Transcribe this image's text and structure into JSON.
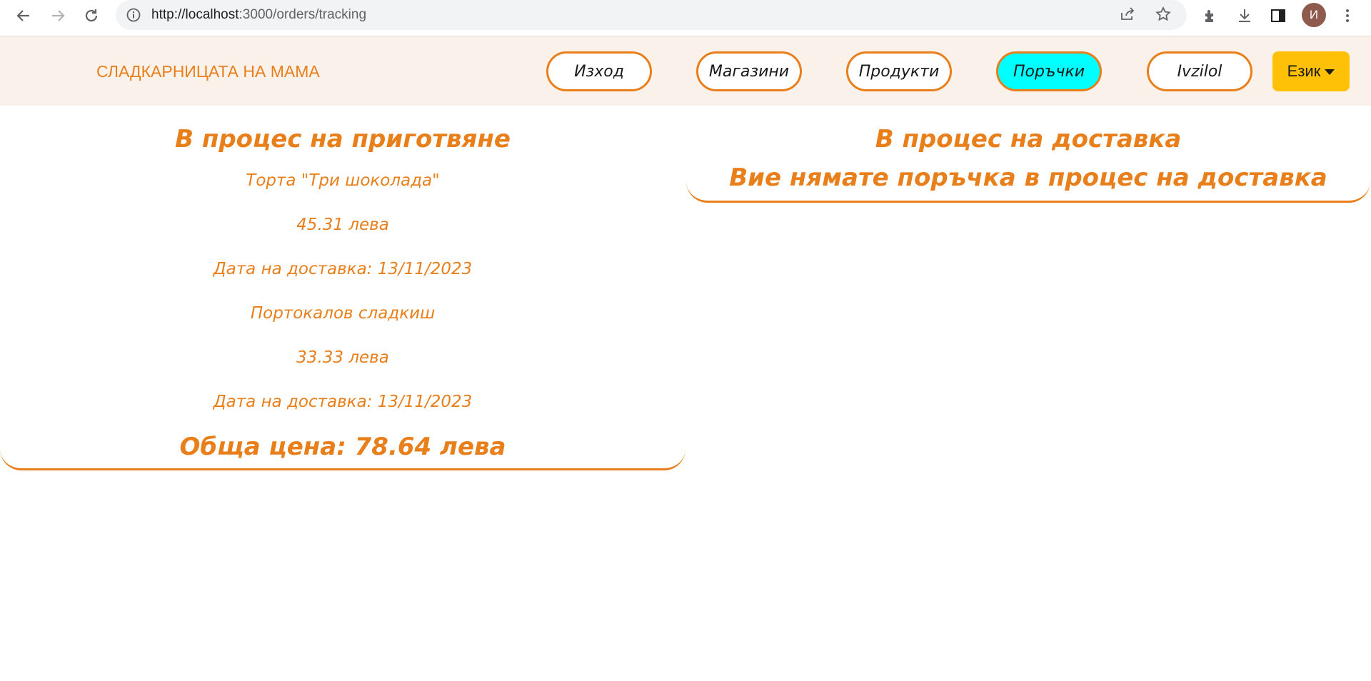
{
  "browser": {
    "url_host": "http://localhost",
    "url_path": ":3000/orders/tracking",
    "avatar_letter": "И"
  },
  "header": {
    "brand": "СЛАДКАРНИЦАТА НА МАМА",
    "nav": {
      "logout": "Изход",
      "stores": "Магазини",
      "products": "Продукти",
      "orders": "Поръчки",
      "user": "Ivzilol"
    },
    "language_label": "Език"
  },
  "in_preparation": {
    "title": "В процес на приготвяне",
    "orders": [
      {
        "name": "Торта \"Три шоколада\"",
        "price": "45.31 лева",
        "delivery": "Дата на доставка: 13/11/2023"
      },
      {
        "name": "Портокалов сладкиш",
        "price": "33.33 лева",
        "delivery": "Дата на доставка: 13/11/2023"
      }
    ],
    "total": "Обща цена: 78.64 лева"
  },
  "in_delivery": {
    "title": "В процес на доставка",
    "empty_message": "Вие нямате поръчка в процес на доставка"
  },
  "colors": {
    "accent": "#e87f1a",
    "active_nav": "#00ffff",
    "language_button": "#ffc107",
    "header_bg": "#faf1eb"
  }
}
